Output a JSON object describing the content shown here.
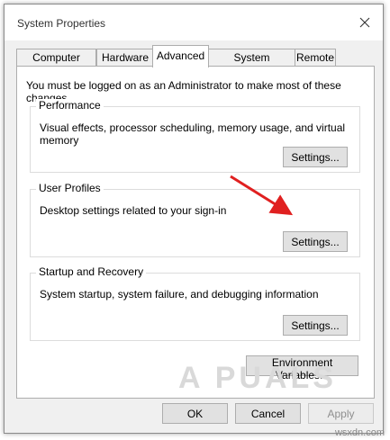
{
  "window": {
    "title": "System Properties"
  },
  "tabs": [
    {
      "label": "Computer Name",
      "active": false
    },
    {
      "label": "Hardware",
      "active": false
    },
    {
      "label": "Advanced",
      "active": true
    },
    {
      "label": "System Protection",
      "active": false
    },
    {
      "label": "Remote",
      "active": false
    }
  ],
  "intro_text": "You must be logged on as an Administrator to make most of these changes.",
  "groups": {
    "performance": {
      "title": "Performance",
      "description": "Visual effects, processor scheduling, memory usage, and virtual memory",
      "button": "Settings..."
    },
    "user_profiles": {
      "title": "User Profiles",
      "description": "Desktop settings related to your sign-in",
      "button": "Settings..."
    },
    "startup_recovery": {
      "title": "Startup and Recovery",
      "description": "System startup, system failure, and debugging information",
      "button": "Settings..."
    }
  },
  "env_button": "Environment Variables...",
  "footer": {
    "ok": "OK",
    "cancel": "Cancel",
    "apply": "Apply",
    "apply_enabled": false
  },
  "annotation_arrow_color": "#e02020",
  "watermark_text": "A  PUALS",
  "site_watermark": "wsxdn.com"
}
